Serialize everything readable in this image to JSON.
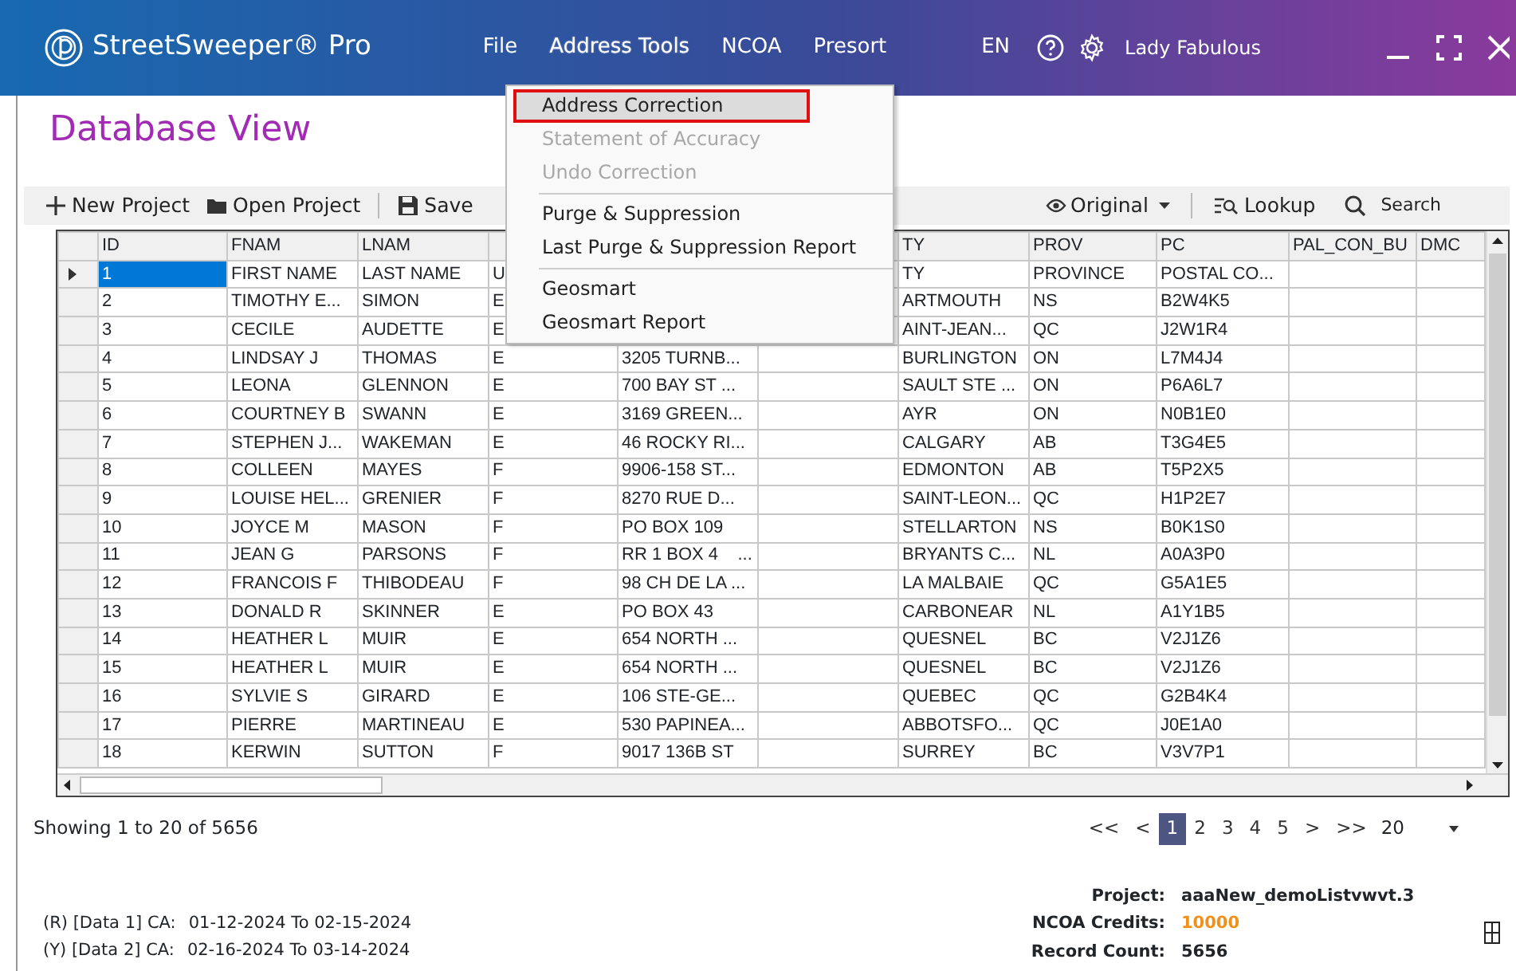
{
  "app": {
    "title": "StreetSweeper® Pro",
    "menus": [
      {
        "label": "File",
        "selected": false
      },
      {
        "label": "Address Tools",
        "selected": true
      },
      {
        "label": "NCOA",
        "selected": false
      },
      {
        "label": "Presort",
        "selected": false
      }
    ],
    "language": "EN",
    "user": "Lady Fabulous"
  },
  "page_title": "Database View",
  "toolbar": {
    "left": [
      {
        "label": "New Project",
        "kind": "plus"
      },
      {
        "label": "Open Project",
        "kind": "folder"
      },
      {
        "label": "Save",
        "kind": "save"
      }
    ],
    "view": "Original",
    "lookup": "Lookup",
    "search": "Search"
  },
  "dropdown_menu": [
    {
      "label": "Address Correction",
      "kind": "item",
      "disabled": false,
      "selected": true
    },
    {
      "label": "Statement of Accuracy",
      "kind": "item",
      "disabled": true,
      "selected": false
    },
    {
      "label": "Undo Correction",
      "kind": "item",
      "disabled": true,
      "selected": false
    },
    {
      "kind": "separator"
    },
    {
      "label": "Purge & Suppression",
      "kind": "item",
      "disabled": false,
      "selected": false
    },
    {
      "label": "Last Purge & Suppression Report",
      "kind": "item",
      "disabled": false,
      "selected": false
    },
    {
      "kind": "separator"
    },
    {
      "label": "Geosmart",
      "kind": "item",
      "disabled": false,
      "selected": false
    },
    {
      "label": "Geosmart Report",
      "kind": "item",
      "disabled": false,
      "selected": false
    }
  ],
  "table": {
    "columns": [
      "ID",
      "FNAM",
      "LNAM",
      null,
      null,
      null,
      "TY",
      "PROV",
      "PC",
      "PAL_CON_BU",
      "DMC"
    ],
    "rows": [
      {
        "selected": true,
        "cells": [
          "1",
          "FIRST NAME",
          "LAST NAME",
          "U",
          null,
          null,
          "TY",
          "PROVINCE",
          "POSTAL CO..."
        ]
      },
      {
        "selected": false,
        "cells": [
          "2",
          "TIMOTHY E...",
          "SIMON",
          "E",
          null,
          null,
          "ARTMOUTH",
          "NS",
          "B2W4K5"
        ]
      },
      {
        "selected": false,
        "cells": [
          "3",
          "CECILE",
          "AUDETTE",
          "E",
          null,
          null,
          "AINT-JEAN...",
          "QC",
          "J2W1R4"
        ]
      },
      {
        "selected": false,
        "cells": [
          "4",
          "LINDSAY J",
          "THOMAS",
          "E",
          "3205 TURNB...",
          null,
          "BURLINGTON",
          "ON",
          "L7M4J4"
        ]
      },
      {
        "selected": false,
        "cells": [
          "5",
          "LEONA",
          "GLENNON",
          "E",
          "700 BAY ST ...",
          null,
          "SAULT STE ...",
          "ON",
          "P6A6L7"
        ]
      },
      {
        "selected": false,
        "cells": [
          "6",
          "COURTNEY B",
          "SWANN",
          "E",
          "3169 GREEN...",
          null,
          "AYR",
          "ON",
          "N0B1E0"
        ]
      },
      {
        "selected": false,
        "cells": [
          "7",
          "STEPHEN J...",
          "WAKEMAN",
          "E",
          "46 ROCKY RI...",
          null,
          "CALGARY",
          "AB",
          "T3G4E5"
        ]
      },
      {
        "selected": false,
        "cells": [
          "8",
          "COLLEEN",
          "MAYES",
          "F",
          "9906-158 ST...",
          null,
          "EDMONTON",
          "AB",
          "T5P2X5"
        ]
      },
      {
        "selected": false,
        "cells": [
          "9",
          "LOUISE HEL...",
          "GRENIER",
          "F",
          "8270 RUE D...",
          null,
          "SAINT-LEON...",
          "QC",
          "H1P2E7"
        ]
      },
      {
        "selected": false,
        "cells": [
          "10",
          "JOYCE M",
          "MASON",
          "F",
          "PO BOX 109",
          null,
          "STELLARTON",
          "NS",
          "B0K1S0"
        ]
      },
      {
        "selected": false,
        "cells": [
          "11",
          "JEAN G",
          "PARSONS",
          "F",
          "RR 1 BOX 4    ...",
          null,
          "BRYANTS C...",
          "NL",
          "A0A3P0"
        ]
      },
      {
        "selected": false,
        "cells": [
          "12",
          "FRANCOIS F",
          "THIBODEAU",
          "F",
          "98 CH DE LA ...",
          null,
          "LA MALBAIE",
          "QC",
          "G5A1E5"
        ]
      },
      {
        "selected": false,
        "cells": [
          "13",
          "DONALD R",
          "SKINNER",
          "E",
          "PO BOX 43",
          null,
          "CARBONEAR",
          "NL",
          "A1Y1B5"
        ]
      },
      {
        "selected": false,
        "cells": [
          "14",
          "HEATHER L",
          "MUIR",
          "E",
          "654 NORTH ...",
          null,
          "QUESNEL",
          "BC",
          "V2J1Z6"
        ]
      },
      {
        "selected": false,
        "cells": [
          "15",
          "HEATHER L",
          "MUIR",
          "E",
          "654 NORTH ...",
          null,
          "QUESNEL",
          "BC",
          "V2J1Z6"
        ]
      },
      {
        "selected": false,
        "cells": [
          "16",
          "SYLVIE S",
          "GIRARD",
          "E",
          "106 STE-GE...",
          null,
          "QUEBEC",
          "QC",
          "G2B4K4"
        ]
      },
      {
        "selected": false,
        "cells": [
          "17",
          "PIERRE",
          "MARTINEAU",
          "E",
          "530 PAPINEA...",
          null,
          "ABBOTSFO...",
          "QC",
          "J0E1A0"
        ]
      },
      {
        "selected": false,
        "cells": [
          "18",
          "KERWIN",
          "SUTTON",
          "F",
          "9017 136B ST",
          null,
          "SURREY",
          "BC",
          "V3V7P1"
        ]
      }
    ]
  },
  "status": "Showing 1 to 20 of 5656",
  "pagination": [
    {
      "label": "<<",
      "selected": false
    },
    {
      "label": "<",
      "selected": false
    },
    {
      "label": "1",
      "selected": true
    },
    {
      "label": "2",
      "selected": false
    },
    {
      "label": "3",
      "selected": false
    },
    {
      "label": "4",
      "selected": false
    },
    {
      "label": "5",
      "selected": false
    },
    {
      "label": ">",
      "selected": false
    },
    {
      "label": ">>",
      "selected": false
    }
  ],
  "page_size": "20",
  "data_ranges": [
    {
      "label": "(R) [Data 1] CA:",
      "range": "01-12-2024 To 02-15-2024"
    },
    {
      "label": "(Y) [Data 2] CA:",
      "range": "02-16-2024 To 03-14-2024"
    }
  ],
  "summary": [
    {
      "label": "Project:",
      "value": "aaaNew_demoListvwvt.3",
      "highlight": false
    },
    {
      "label": "NCOA Credits:",
      "value": "10000",
      "highlight": true
    },
    {
      "label": "Record Count:",
      "value": "5656",
      "highlight": false
    }
  ]
}
